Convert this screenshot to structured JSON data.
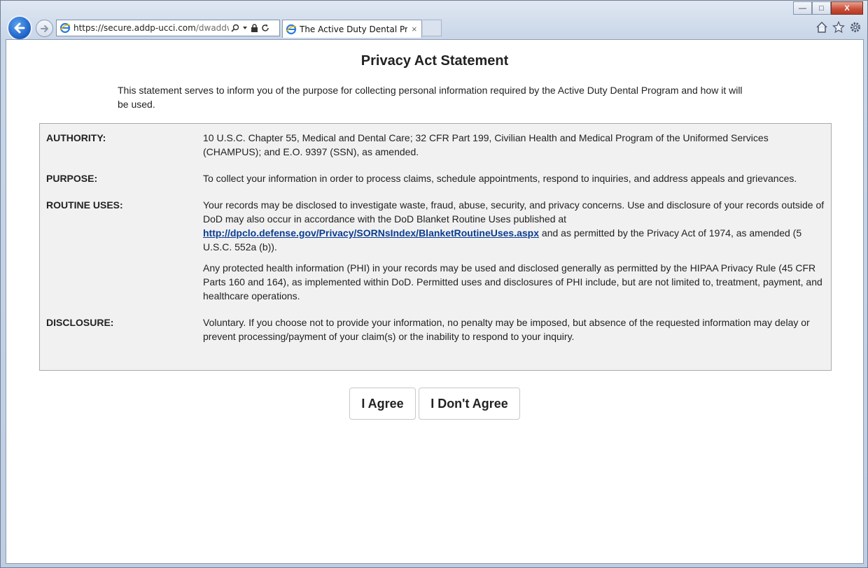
{
  "browser": {
    "url_main": "https://secure.addp-ucci.com",
    "url_dim": "/dwaddw/pr",
    "tab_title": "The Active Duty Dental Pro...",
    "tab_close": "×",
    "win_controls": {
      "minimize": "—",
      "maximize": "□",
      "close": "X"
    }
  },
  "page": {
    "title": "Privacy Act Statement",
    "intro": "This statement serves to inform you of the purpose for collecting personal information required by the Active Duty Dental Program and how it will be used.",
    "sections": {
      "authority": {
        "label": "AUTHORITY:",
        "text": "10 U.S.C. Chapter 55, Medical and Dental Care; 32 CFR Part 199, Civilian Health and Medical Program of the Uniformed Services (CHAMPUS); and E.O. 9397 (SSN), as amended."
      },
      "purpose": {
        "label": "PURPOSE:",
        "text": "To collect your information in order to process claims, schedule appointments, respond to inquiries, and address appeals and grievances."
      },
      "routine_uses": {
        "label": "ROUTINE USES:",
        "p1_before": "Your records may be disclosed to investigate waste, fraud, abuse, security, and privacy concerns. Use and disclosure of your records outside of DoD may also occur in accordance with the DoD Blanket Routine Uses published at ",
        "link": "http://dpclo.defense.gov/Privacy/SORNsIndex/BlanketRoutineUses.aspx",
        "p1_after": " and as permitted by the Privacy Act of 1974, as amended (5 U.S.C. 552a (b)).",
        "p2": "Any protected health information (PHI) in your records may be used and disclosed generally as permitted by the HIPAA Privacy Rule (45 CFR Parts 160 and 164), as implemented within DoD. Permitted uses and disclosures of PHI include, but are not limited to, treatment, payment, and healthcare operations."
      },
      "disclosure": {
        "label": "DISCLOSURE:",
        "text": "Voluntary. If you choose not to provide your information, no penalty may be imposed, but absence of the requested information may delay or prevent processing/payment of your claim(s) or the inability to respond to your inquiry."
      }
    },
    "buttons": {
      "agree": "I Agree",
      "disagree": "I Don't Agree"
    }
  },
  "icons": {
    "back": "back-arrow-icon",
    "forward": "forward-arrow-icon",
    "site": "ie-logo-icon",
    "search": "search-icon",
    "dropdown": "dropdown-arrow-icon",
    "lock": "lock-icon",
    "refresh": "refresh-icon",
    "home": "home-icon",
    "favorites": "star-icon",
    "tools": "gear-icon"
  },
  "colors": {
    "link": "#0b3d91",
    "panel_bg": "#f1f1f1",
    "close_button": "#c74d36",
    "back_button": "#1d5fc4"
  }
}
